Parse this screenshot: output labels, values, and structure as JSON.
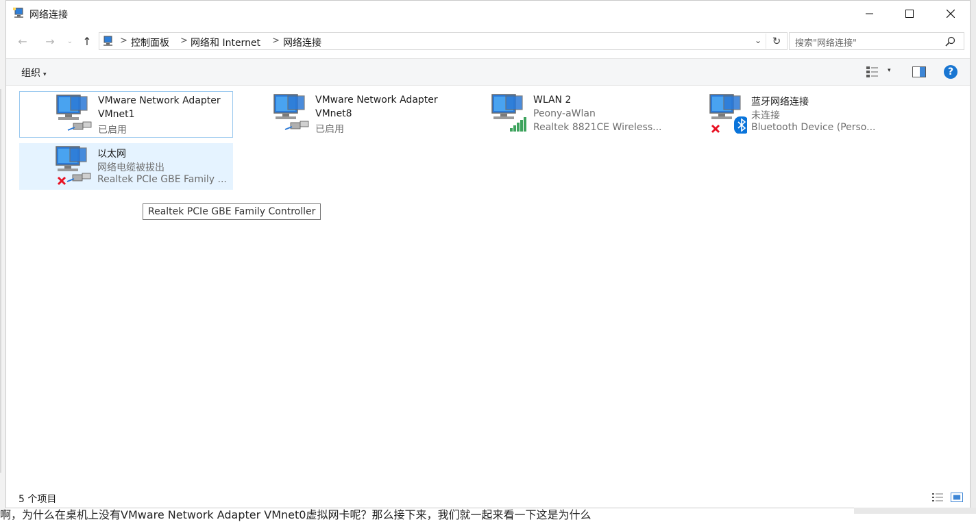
{
  "window": {
    "title": "网络连接",
    "controls": {
      "minimize": "minimize",
      "maximize": "maximize",
      "close": "close"
    }
  },
  "nav": {
    "back": "←",
    "forward": "→",
    "recent": "⌄",
    "up": "↑",
    "breadcrumb": [
      "控制面板",
      "网络和 Internet",
      "网络连接"
    ],
    "separator": ">",
    "refresh": "↻",
    "dropdown": "⌄"
  },
  "search": {
    "placeholder": "搜索\"网络连接\""
  },
  "toolbar": {
    "organize": "组织",
    "caret": "▾",
    "help": "?"
  },
  "items": [
    {
      "name": "VMware Network Adapter VMnet1",
      "line1": "VMware Network Adapter",
      "line2": "VMnet1",
      "status": "已启用",
      "device": "",
      "icon": "network-adapter-icon",
      "badge": "cable-icon",
      "error": false
    },
    {
      "name": "VMware Network Adapter VMnet8",
      "line1": "VMware Network Adapter",
      "line2": "VMnet8",
      "status": "已启用",
      "device": "",
      "icon": "network-adapter-icon",
      "badge": "cable-icon",
      "error": false
    },
    {
      "name": "WLAN 2",
      "line1": "WLAN 2",
      "line2": "Peony-aWlan",
      "status": "",
      "device": "Realtek 8821CE Wireless...",
      "icon": "wireless-adapter-icon",
      "badge": "signal-bars-icon",
      "error": false
    },
    {
      "name": "蓝牙网络连接",
      "line1": "蓝牙网络连接",
      "line2": "未连接",
      "status": "",
      "device": "Bluetooth Device (Perso...",
      "icon": "bluetooth-adapter-icon",
      "badge": "bluetooth-icon",
      "error": true
    },
    {
      "name": "以太网",
      "line1": "以太网",
      "line2": "网络电缆被拔出",
      "status": "",
      "device": "Realtek PCIe GBE Family ...",
      "icon": "ethernet-adapter-icon",
      "badge": "cable-icon",
      "error": true
    }
  ],
  "tooltip": "Realtek PCIe GBE Family Controller",
  "status": {
    "count": "5 个项目"
  },
  "background_text": "啊，为什么在桌机上没有VMware Network Adapter VMnet0虚拟网卡呢？那么接下来，我们就一起来看一下这是为什么",
  "colors": {
    "selection": "#e5f3ff",
    "focus_border": "#99c8ef",
    "help": "#1976d2",
    "error_red": "#e81123",
    "signal_green": "#3da35d",
    "bluetooth_blue": "#0a74da"
  }
}
